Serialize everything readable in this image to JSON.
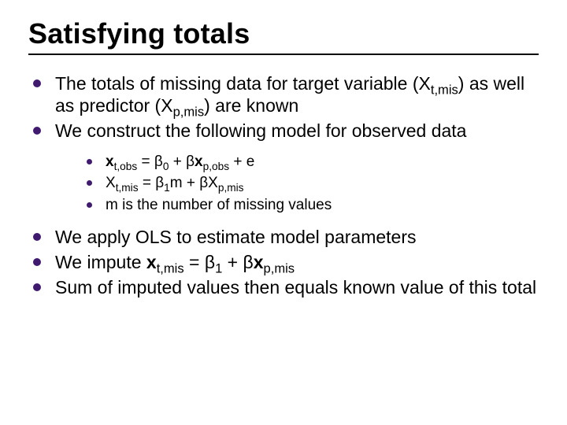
{
  "title": "Satisfying totals",
  "bullets": {
    "b1_a": "The totals of missing data for target variable (X",
    "b1_sub1": "t,mis",
    "b1_b": ") as well as predictor (X",
    "b1_sub2": "p,mis",
    "b1_c": ") are known",
    "b2": "We construct the following model for observed data",
    "s1_a": "x",
    "s1_sub1": "t,obs",
    "s1_b": " = β",
    "s1_sub2": "0",
    "s1_c": " + β",
    "s1_d": "x",
    "s1_sub3": "p,obs",
    "s1_e": " + e",
    "s2_a": "X",
    "s2_sub1": "t,mis",
    "s2_b": " = β",
    "s2_sub2": "1",
    "s2_c": "m + βX",
    "s2_sub3": "p,mis",
    "s3": "m is the number of missing values",
    "b3": "We apply OLS to estimate model parameters",
    "b4_a": "We impute ",
    "b4_b": "x",
    "b4_sub1": "t,mis",
    "b4_c": " = β",
    "b4_sub2": "1",
    "b4_d": " + β",
    "b4_e": "x",
    "b4_sub3": "p,mis",
    "b5": "Sum of imputed values then equals known value of this total"
  }
}
